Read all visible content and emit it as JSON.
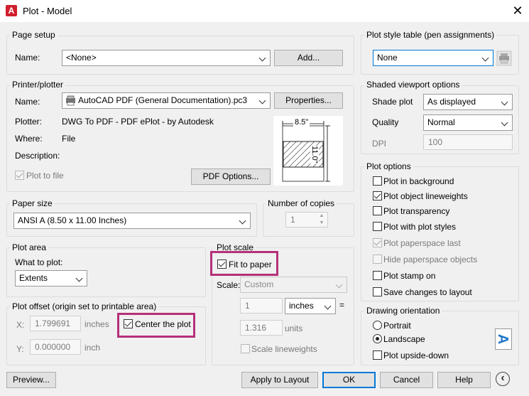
{
  "window": {
    "title": "Plot - Model",
    "app_icon": "A",
    "close": "✕"
  },
  "page_setup": {
    "label": "Page setup",
    "name_label": "Name:",
    "name_value": "<None>",
    "add_button": "Add..."
  },
  "printer": {
    "label": "Printer/plotter",
    "name_label": "Name:",
    "name_value": "AutoCAD PDF (General Documentation).pc3",
    "properties_button": "Properties...",
    "plotter_label": "Plotter:",
    "plotter_value": "DWG To PDF - PDF ePlot - by Autodesk",
    "where_label": "Where:",
    "where_value": "File",
    "description_label": "Description:",
    "plot_to_file": "Plot to file",
    "pdf_options_button": "PDF Options...",
    "preview_width": "8.5\"",
    "preview_height": "11.0\""
  },
  "paper_size": {
    "label": "Paper size",
    "value": "ANSI A (8.50 x 11.00 Inches)"
  },
  "copies": {
    "label": "Number of copies",
    "value": "1"
  },
  "plot_area": {
    "label": "Plot area",
    "what_label": "What to plot:",
    "what_value": "Extents"
  },
  "plot_offset": {
    "label": "Plot offset (origin set to printable area)",
    "x_label": "X:",
    "x_value": "1.799691",
    "x_unit": "inches",
    "y_label": "Y:",
    "y_value": "0.000000",
    "y_unit": "inch",
    "center_label": "Center the plot"
  },
  "plot_scale": {
    "label": "Plot scale",
    "fit_label": "Fit to paper",
    "scale_label": "Scale:",
    "scale_value": "Custom",
    "num1": "1",
    "unit1": "inches",
    "equals": "=",
    "num2": "1.316",
    "unit2": "units",
    "lineweights": "Scale lineweights"
  },
  "style_table": {
    "label": "Plot style table (pen assignments)",
    "value": "None"
  },
  "shaded": {
    "label": "Shaded viewport options",
    "shade_label": "Shade plot",
    "shade_value": "As displayed",
    "quality_label": "Quality",
    "quality_value": "Normal",
    "dpi_label": "DPI",
    "dpi_value": "100"
  },
  "plot_options": {
    "label": "Plot options",
    "items": [
      "Plot in background",
      "Plot object lineweights",
      "Plot transparency",
      "Plot with plot styles",
      "Plot paperspace last",
      "Hide paperspace objects",
      "Plot stamp on",
      "Save changes to layout"
    ]
  },
  "orientation": {
    "label": "Drawing orientation",
    "portrait": "Portrait",
    "landscape": "Landscape",
    "upside_down": "Plot upside-down",
    "icon_letter": "A"
  },
  "buttons": {
    "preview": "Preview...",
    "apply": "Apply to Layout",
    "ok": "OK",
    "cancel": "Cancel",
    "help": "Help",
    "collapse": "‹"
  },
  "colors": {
    "highlight": "#b5307a",
    "accent": "#0078d7",
    "brand": "#d0202d"
  }
}
